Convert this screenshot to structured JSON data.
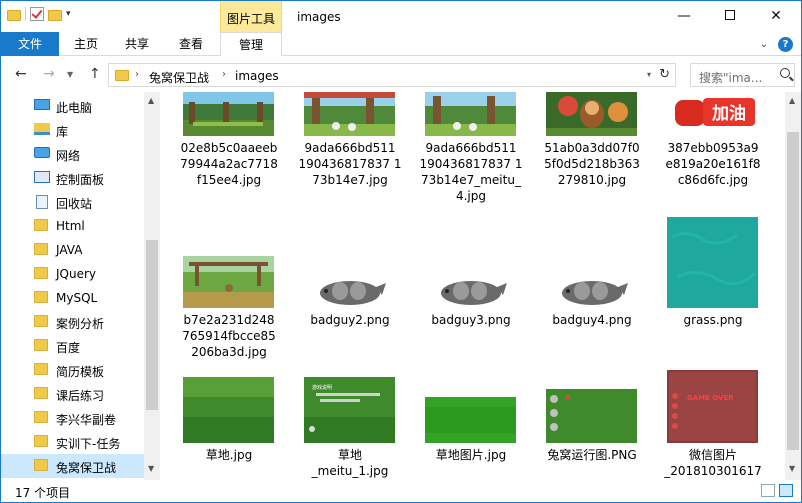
{
  "window": {
    "title": "images",
    "context_tab": "图片工具",
    "minimize": "—",
    "close": "✕"
  },
  "ribbon": {
    "tabs": [
      "文件",
      "主页",
      "共享",
      "查看",
      "管理"
    ]
  },
  "address": {
    "crumbs": [
      "兔窝保卫战",
      "images"
    ],
    "search_placeholder": "搜索\"ima...",
    "back": "←",
    "forward": "→",
    "up": "↑",
    "refresh": "↻"
  },
  "sidebar": {
    "items": [
      {
        "label": "此电脑",
        "icon": "pc"
      },
      {
        "label": "库",
        "icon": "library"
      },
      {
        "label": "网络",
        "icon": "network"
      },
      {
        "label": "控制面板",
        "icon": "control-panel"
      },
      {
        "label": "回收站",
        "icon": "recycle-bin"
      },
      {
        "label": "Html",
        "icon": "folder"
      },
      {
        "label": "JAVA",
        "icon": "folder"
      },
      {
        "label": "JQuery",
        "icon": "folder"
      },
      {
        "label": "MySQL",
        "icon": "folder"
      },
      {
        "label": "案例分析",
        "icon": "folder"
      },
      {
        "label": "百度",
        "icon": "folder"
      },
      {
        "label": "简历模板",
        "icon": "folder"
      },
      {
        "label": "课后练习",
        "icon": "folder"
      },
      {
        "label": "李兴华副卷",
        "icon": "folder"
      },
      {
        "label": "实训下-任务",
        "icon": "folder"
      },
      {
        "label": "兔窝保卫战",
        "icon": "folder",
        "selected": true
      }
    ]
  },
  "files": {
    "row1": [
      {
        "name": "02e8b5c0aaeeb79944a2ac7718f15ee4.jpg",
        "lines": [
          "02e8b5c0aaeeb",
          "79944a2ac7718",
          "f15ee4.jpg"
        ],
        "thumb": "forest"
      },
      {
        "name": "9ada666bd5111904368178371 73b14e7.jpg",
        "lines": [
          "9ada666bd511",
          "190436817837 1",
          "73b14e7.jpg"
        ],
        "thumb": "forest-bunny"
      },
      {
        "name": "9ada666bd511190436817837173b14e7_meitu_4.jpg",
        "lines": [
          "9ada666bd511",
          "190436817837 1",
          "73b14e7_meitu_",
          "4.jpg"
        ],
        "thumb": "forest-bunny"
      },
      {
        "name": "51ab0a3dd07f05f0d5d218b363279810.jpg",
        "lines": [
          "51ab0a3dd07f0",
          "5f0d5d218b363",
          "279810.jpg"
        ],
        "thumb": "monkey"
      },
      {
        "name": "387ebb0953a9e819a20e161f8c86d6fc.jpg",
        "lines": [
          "387ebb0953a9",
          "e819a20e161f8",
          "c86d6fc.jpg"
        ],
        "thumb": "jiayou"
      }
    ],
    "row1_thumb_text": "加油",
    "row2": [
      {
        "name": "b7e2a231d248765914fbcce85206ba3d.jpg",
        "lines": [
          "b7e2a231d248",
          "765914fbcce85",
          "206ba3d.jpg"
        ],
        "thumb": "forest2"
      },
      {
        "name": "badguy2.png",
        "lines": [
          "badguy2.png"
        ],
        "thumb": "badguy"
      },
      {
        "name": "badguy3.png",
        "lines": [
          "badguy3.png"
        ],
        "thumb": "badguy"
      },
      {
        "name": "badguy4.png",
        "lines": [
          "badguy4.png"
        ],
        "thumb": "badguy"
      },
      {
        "name": "grass.png",
        "lines": [
          "grass.png"
        ],
        "thumb": "teal"
      }
    ],
    "row3": [
      {
        "name": "草地.jpg",
        "lines": [
          "草地.jpg"
        ],
        "thumb": "grass"
      },
      {
        "name": "草地_meitu_1.jpg",
        "lines": [
          "草地",
          "_meitu_1.jpg"
        ],
        "thumb": "grass-text"
      },
      {
        "name": "草地图片.jpg",
        "lines": [
          "草地图片.jpg"
        ],
        "thumb": "grass-bright"
      },
      {
        "name": "兔窝运行图.PNG",
        "lines": [
          "兔窝运行图.PNG"
        ],
        "thumb": "grass-holes"
      },
      {
        "name": "微信图片_201810301617",
        "lines": [
          "微信图片",
          "_201810301617"
        ],
        "thumb": "red-game"
      }
    ],
    "row3_thumb_text_a": "游戏说明",
    "row3_thumb_text_b": "GAME OVER"
  },
  "status": {
    "count": "17 个项目"
  },
  "colors": {
    "accent": "#1979ca",
    "context_tab": "#fce99a",
    "selection": "#cce8ff"
  }
}
